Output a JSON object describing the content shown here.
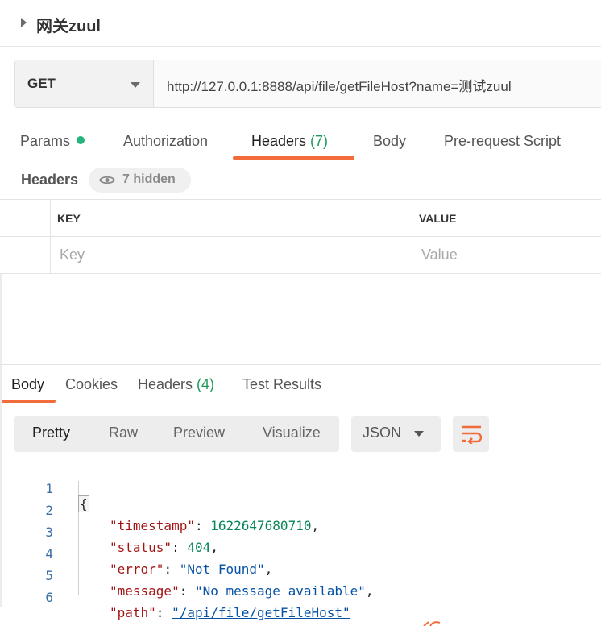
{
  "request": {
    "name": "网关zuul",
    "method": "GET",
    "url": "http://127.0.0.1:8888/api/file/getFileHost?name=测试zuul"
  },
  "request_tabs": [
    {
      "label": "Params"
    },
    {
      "label": "Authorization"
    },
    {
      "label": "Headers ",
      "count": "(7)"
    },
    {
      "label": "Body"
    },
    {
      "label": "Pre-request Script"
    }
  ],
  "headers_section": {
    "label": "Headers",
    "hidden_label": "7 hidden",
    "columns": {
      "key": "KEY",
      "value": "VALUE"
    },
    "placeholders": {
      "key": "Key",
      "value": "Value"
    }
  },
  "response_tabs": [
    {
      "label": "Body"
    },
    {
      "label": "Cookies"
    },
    {
      "label": "Headers ",
      "count": "(4)"
    },
    {
      "label": "Test Results"
    }
  ],
  "view_modes": [
    "Pretty",
    "Raw",
    "Preview",
    "Visualize"
  ],
  "format": "JSON",
  "code": {
    "line_numbers": [
      "1",
      "2",
      "3",
      "4",
      "5",
      "6"
    ],
    "open_brace": "{",
    "fields": [
      {
        "key": "\"timestamp\"",
        "value": "1622647680710",
        "comma": ","
      },
      {
        "key": "\"status\"",
        "value": "404",
        "comma": ","
      },
      {
        "key": "\"error\"",
        "value": "\"Not Found\"",
        "comma": ","
      },
      {
        "key": "\"message\"",
        "value": "\"No message available\"",
        "comma": ","
      },
      {
        "key": "\"path\"",
        "value": "\"/api/file/getFileHost\"",
        "comma": ""
      }
    ]
  },
  "colors": {
    "accent": "#f26b3a",
    "count_green": "#1f9a5a",
    "dot_green": "#26b47f",
    "json_key": "#a31515",
    "json_number": "#098658",
    "json_string": "#0451a5"
  }
}
